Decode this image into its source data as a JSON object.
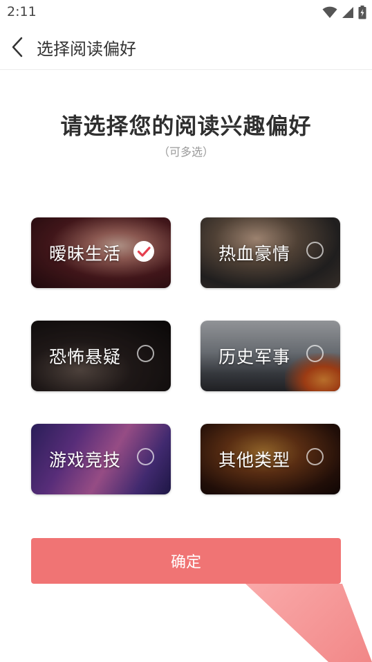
{
  "status_bar": {
    "time": "2:11"
  },
  "nav": {
    "title": "选择阅读偏好"
  },
  "heading": {
    "title": "请选择您的阅读兴趣偏好",
    "subtitle": "（可多选）"
  },
  "categories": [
    {
      "label": "暧昧生活",
      "selected": true
    },
    {
      "label": "热血豪情",
      "selected": false
    },
    {
      "label": "恐怖悬疑",
      "selected": false
    },
    {
      "label": "历史军事",
      "selected": false
    },
    {
      "label": "游戏竞技",
      "selected": false
    },
    {
      "label": "其他类型",
      "selected": false
    }
  ],
  "confirm_button": {
    "label": "确定"
  },
  "colors": {
    "accent": "#f07474",
    "check": "#e5404f"
  }
}
